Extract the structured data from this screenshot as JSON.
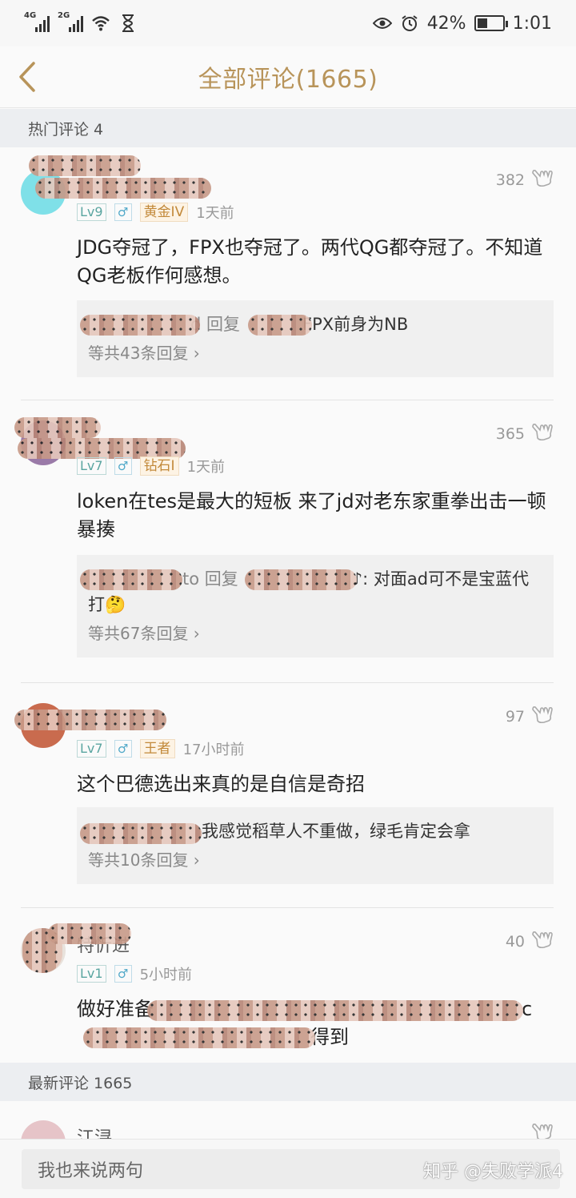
{
  "status_bar": {
    "sig1": "4G",
    "sig2": "2G",
    "battery": "42%",
    "time": "1:01",
    "battery_level": 0.42
  },
  "header": {
    "title": "全部评论(1665)"
  },
  "sections": {
    "hot": "热门评论 4",
    "latest": "最新评论 1665"
  },
  "comments": [
    {
      "likes": "382",
      "level": "Lv9",
      "sex": "♂",
      "rank": "黄金IV",
      "time": "1天前",
      "text": "JDG夺冠了，FPX也夺冠了。两代QG都夺冠了。不知道QG老板作何感想。",
      "reply_prefix": "d 回复",
      "reply_text": "FPX前身为NB",
      "more": "等共43条回复"
    },
    {
      "likes": "365",
      "level": "Lv7",
      "sex": "♂",
      "rank": "钻石I",
      "time": "1天前",
      "text": "loken在tes是最大的短板 来了jd对老东家重拳出击一顿暴揍",
      "reply_prefix": "to 回复",
      "reply_text": "♪: 对面ad可不是宝蓝代打🤔",
      "more": "等共67条回复"
    },
    {
      "likes": "97",
      "level": "Lv7",
      "sex": "♂",
      "rank": "王者",
      "time": "17小时前",
      "text": "这个巴德选出来真的是自信是奇招",
      "reply_text": "我感觉稻草人不重做，绿毛肯定会拿",
      "more": "等共10条回复"
    },
    {
      "username": "特忻进",
      "likes": "40",
      "level": "Lv1",
      "sex": "♂",
      "time": "5小时前",
      "text_start": "做好准备",
      "text_end": "c",
      "text_line2": "得到"
    },
    {
      "username": "江浔"
    }
  ],
  "bottom": {
    "input_placeholder": "我也来说两句",
    "watermark": "知乎 @失败学派4"
  },
  "colors": {
    "accent": "#b8945a",
    "level": "#5aa5a0",
    "rank": "#c2893a"
  }
}
